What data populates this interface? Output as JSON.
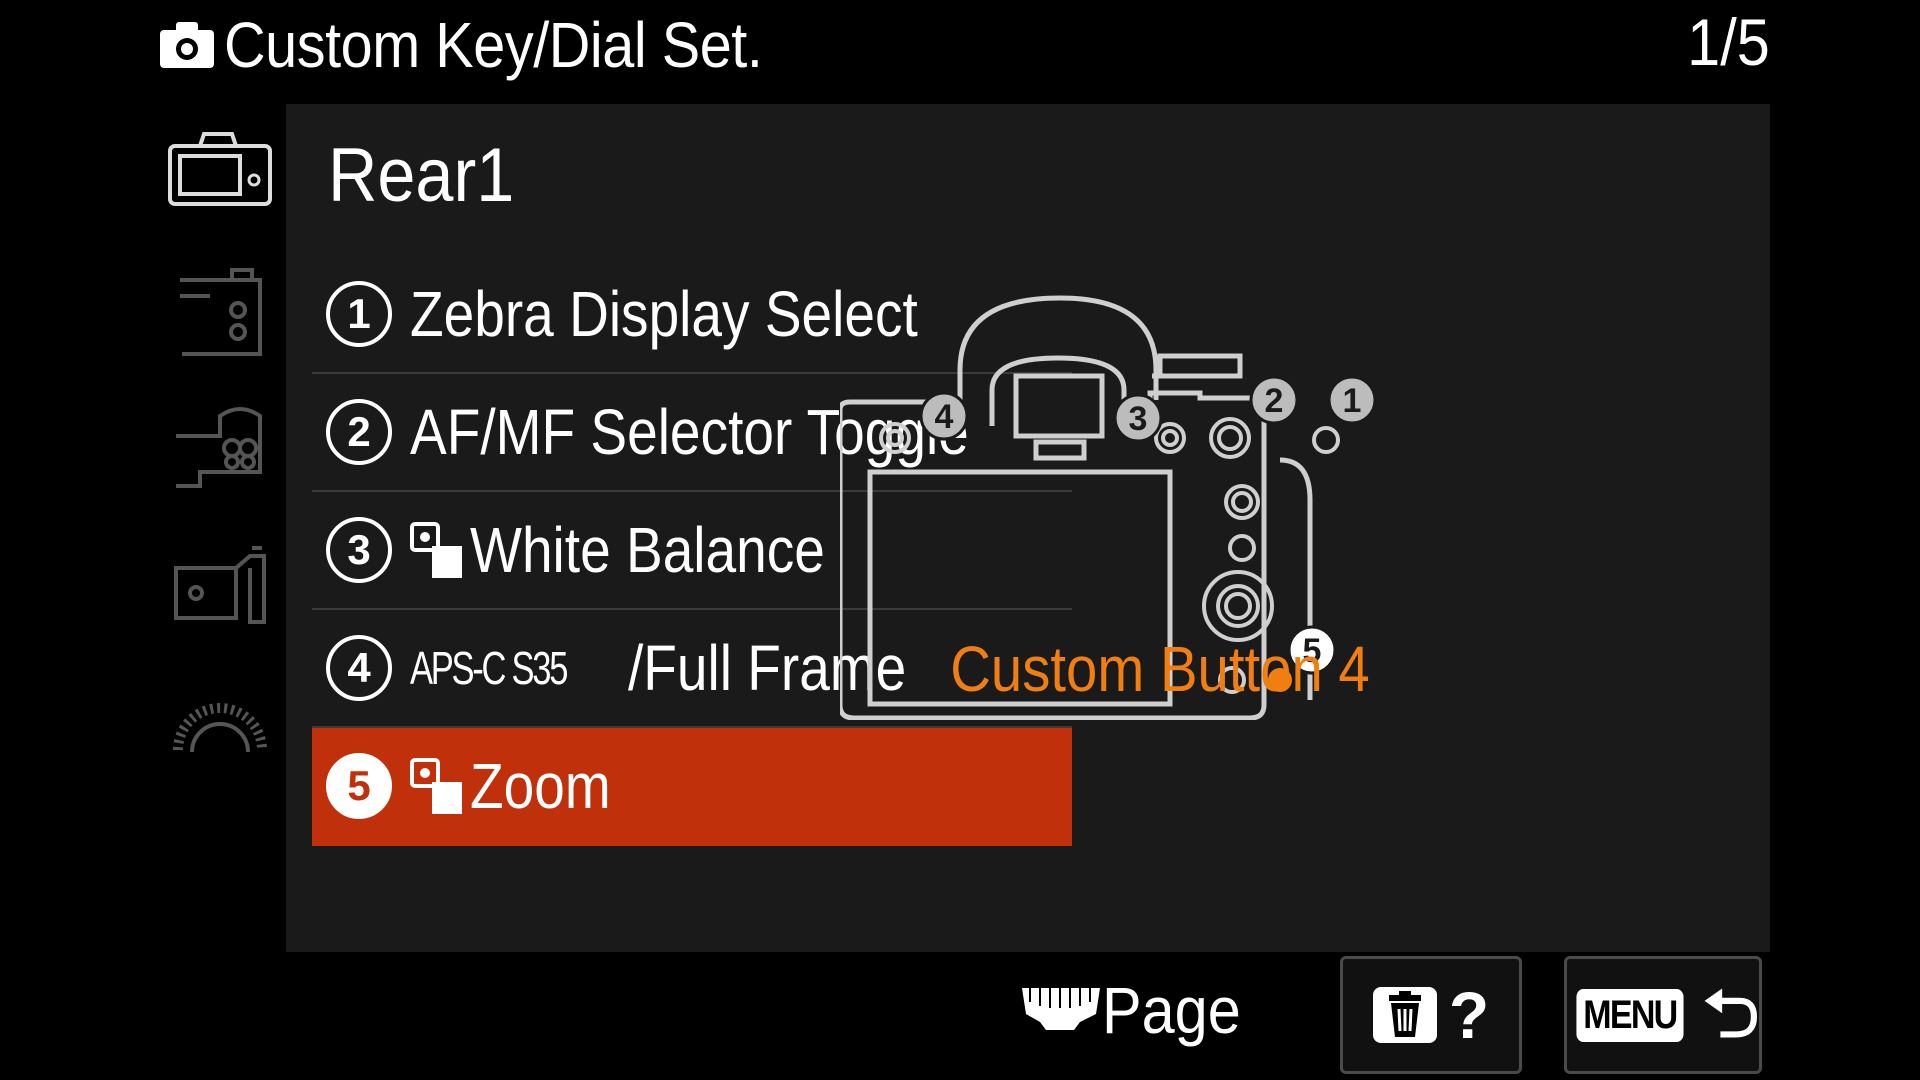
{
  "header": {
    "title": "Custom Key/Dial Set.",
    "page_indicator": "1/5"
  },
  "tabs": [
    {
      "icon": "camera-body-rear-icon",
      "active": true
    },
    {
      "icon": "camera-body-front-icon",
      "active": false
    },
    {
      "icon": "camera-lens-side-icon",
      "active": false
    },
    {
      "icon": "camera-side-icon",
      "active": false
    },
    {
      "icon": "dial-icon",
      "active": false
    }
  ],
  "section": {
    "title": "Rear1"
  },
  "items": [
    {
      "number": "1",
      "label": "Zebra Display Select",
      "prefix": "",
      "selected": false
    },
    {
      "number": "2",
      "label": "AF/MF Selector Toggle",
      "prefix": "",
      "selected": false
    },
    {
      "number": "3",
      "label": "White Balance",
      "prefix": "movie-still-icon",
      "selected": false
    },
    {
      "number": "4",
      "label": "/Full Frame",
      "prefix_text": "APS-C S35",
      "selected": false
    },
    {
      "number": "5",
      "label": "Zoom",
      "prefix": "movie-still-icon",
      "selected": true
    }
  ],
  "diagram": {
    "callouts": [
      "1",
      "2",
      "3",
      "4",
      "5"
    ],
    "caption": "Custom Button 4"
  },
  "footer": {
    "page_label": "Page",
    "help_label": "?",
    "menu_label": "MENU"
  },
  "colors": {
    "background": "#000000",
    "panel": "#1a1a1a",
    "selected": "#c0300b",
    "caption": "#f07e10",
    "highlight_dot": "#f07e10"
  }
}
